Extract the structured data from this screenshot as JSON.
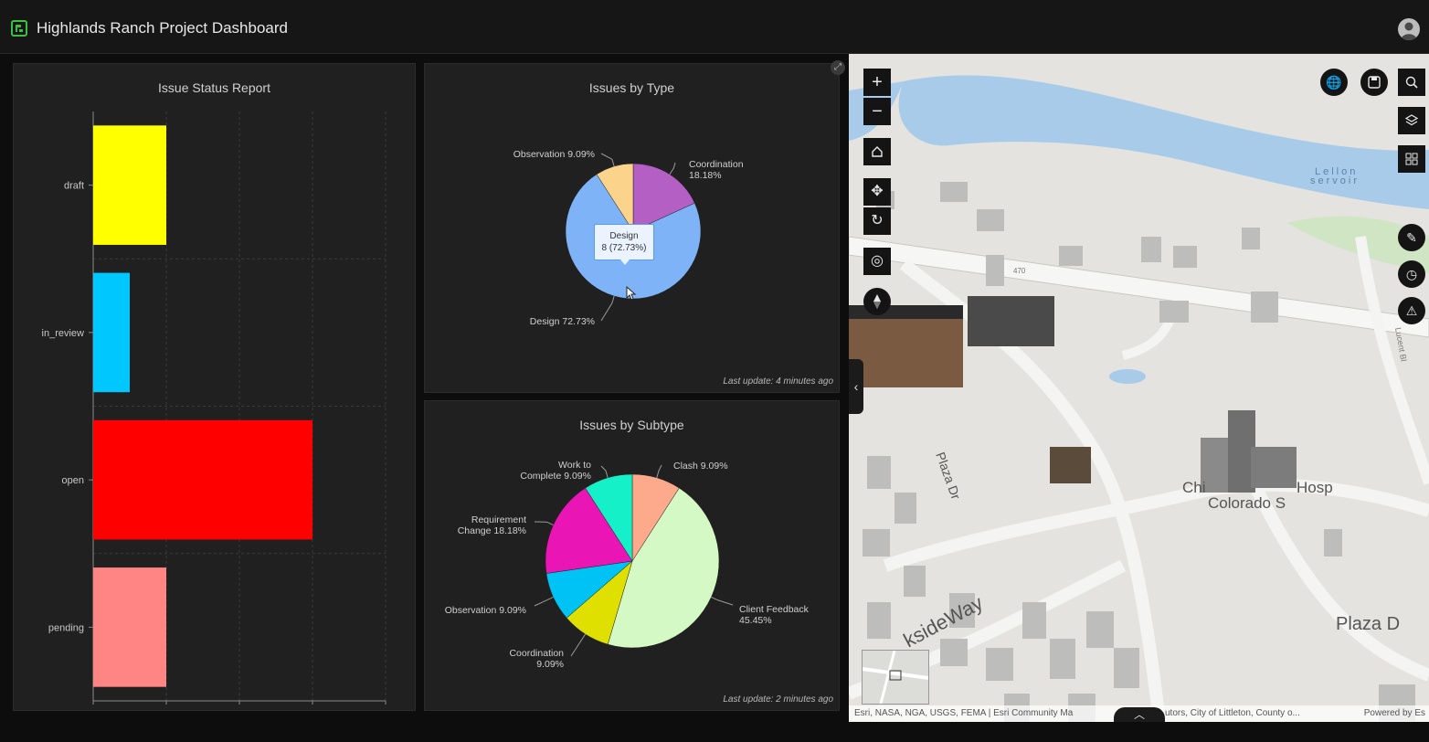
{
  "app": {
    "title": "Highlands Ranch Project Dashboard",
    "brand_color": "#3fbf3f"
  },
  "issue_status": {
    "title": "Issue Status Report"
  },
  "issues_by_type": {
    "title": "Issues by Type",
    "tooltip_title": "Design",
    "tooltip_value": "8 (72.73%)",
    "last_update": "Last update: 4 minutes ago"
  },
  "issues_by_subtype": {
    "title": "Issues by Subtype",
    "last_update": "Last update: 2 minutes ago"
  },
  "map": {
    "attribution": "Esri, NASA, NGA, USGS, FEMA | Esri Community Ma",
    "attribution_tail": "utors, City of Littleton, County o...",
    "powered_by": "Powered by Es",
    "labels": {
      "street_1": "Plaza Dr",
      "street_2": "Plaza D",
      "street_3": "ksideWay",
      "hospital_1": "Chi",
      "hospital_2": "Hosp",
      "hospital_3": "Colorado S",
      "reservoir_1": "Lellon",
      "reservoir_2": "servoir",
      "highway": "470",
      "side_road": "Lucent Bl"
    }
  },
  "chart_data": [
    {
      "type": "bar",
      "orientation": "horizontal",
      "title": "Issue Status Report",
      "categories": [
        "draft",
        "in_review",
        "open",
        "pending"
      ],
      "values": [
        1,
        0.5,
        3,
        1
      ],
      "colors": [
        "#ffff00",
        "#00c8ff",
        "#ff0000",
        "#ff8585"
      ],
      "xlim": [
        0,
        4
      ],
      "grid": true
    },
    {
      "type": "pie",
      "title": "Issues by Type",
      "series": [
        {
          "label": "Coordination",
          "value": 18.18,
          "display": "18.18%",
          "color": "#b35fc4"
        },
        {
          "label": "Design",
          "value": 72.73,
          "display": "72.73%",
          "color": "#7eb4f7"
        },
        {
          "label": "Observation",
          "value": 9.09,
          "display": "9.09%",
          "color": "#fbd38a"
        }
      ]
    },
    {
      "type": "pie",
      "title": "Issues by Subtype",
      "series": [
        {
          "label": "Clash",
          "value": 9.09,
          "display": "9.09%",
          "color": "#fda98c"
        },
        {
          "label": "Client Feedback",
          "value": 45.45,
          "display": "45.45%",
          "color": "#d4f9c4"
        },
        {
          "label": "Coordination",
          "value": 9.09,
          "display": "9.09%",
          "color": "#e0e000"
        },
        {
          "label": "Observation",
          "value": 9.09,
          "display": "9.09%",
          "color": "#00c3f5"
        },
        {
          "label": "Requirement Change",
          "value": 18.18,
          "display": "18.18%",
          "color": "#e916b5"
        },
        {
          "label": "Work to Complete",
          "value": 9.09,
          "display": "9.09%",
          "color": "#16f0c8"
        }
      ]
    }
  ]
}
